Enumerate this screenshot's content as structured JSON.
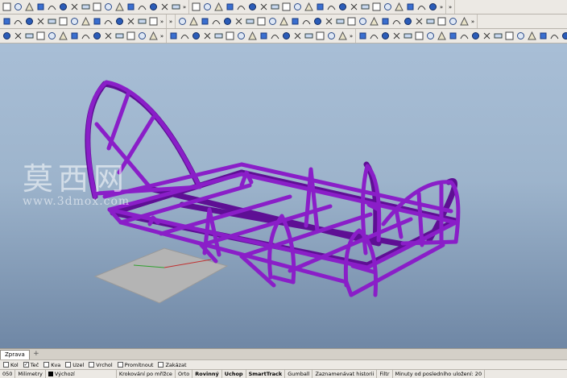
{
  "viewport": {
    "watermark_cn": "莫西网",
    "watermark_url": "www.3dmox.com"
  },
  "view_tabs": [
    {
      "label": "Zprava"
    }
  ],
  "tab_add_symbol": "+",
  "toolbar_more": "»",
  "osnaps": [
    {
      "label": "Kol",
      "checked": false
    },
    {
      "label": "Teč",
      "checked": true
    },
    {
      "label": "Kva",
      "checked": false
    },
    {
      "label": "Uzel",
      "checked": false
    },
    {
      "label": "Vrchol",
      "checked": false
    },
    {
      "label": "Promítnout",
      "checked": false
    },
    {
      "label": "Zakázat",
      "checked": false
    }
  ],
  "status": {
    "coord": "050",
    "units": "Milimetry",
    "layer": "Výchozí",
    "items": [
      {
        "label": "Krokování po mřížce",
        "bold": false
      },
      {
        "label": "Orto",
        "bold": false
      },
      {
        "label": "Rovinný",
        "bold": true
      },
      {
        "label": "Uchop",
        "bold": true
      },
      {
        "label": "SmartTrack",
        "bold": true
      },
      {
        "label": "Gumball",
        "bold": false
      },
      {
        "label": "Zaznamenávat historii",
        "bold": false
      },
      {
        "label": "Filtr",
        "bold": false
      },
      {
        "label": "Minuty od posledního uložení: 20",
        "bold": false
      }
    ]
  },
  "colors": {
    "frame": "#8a1ec8",
    "frame_dark": "#5e0f94",
    "grid": "#b4b4b4"
  }
}
